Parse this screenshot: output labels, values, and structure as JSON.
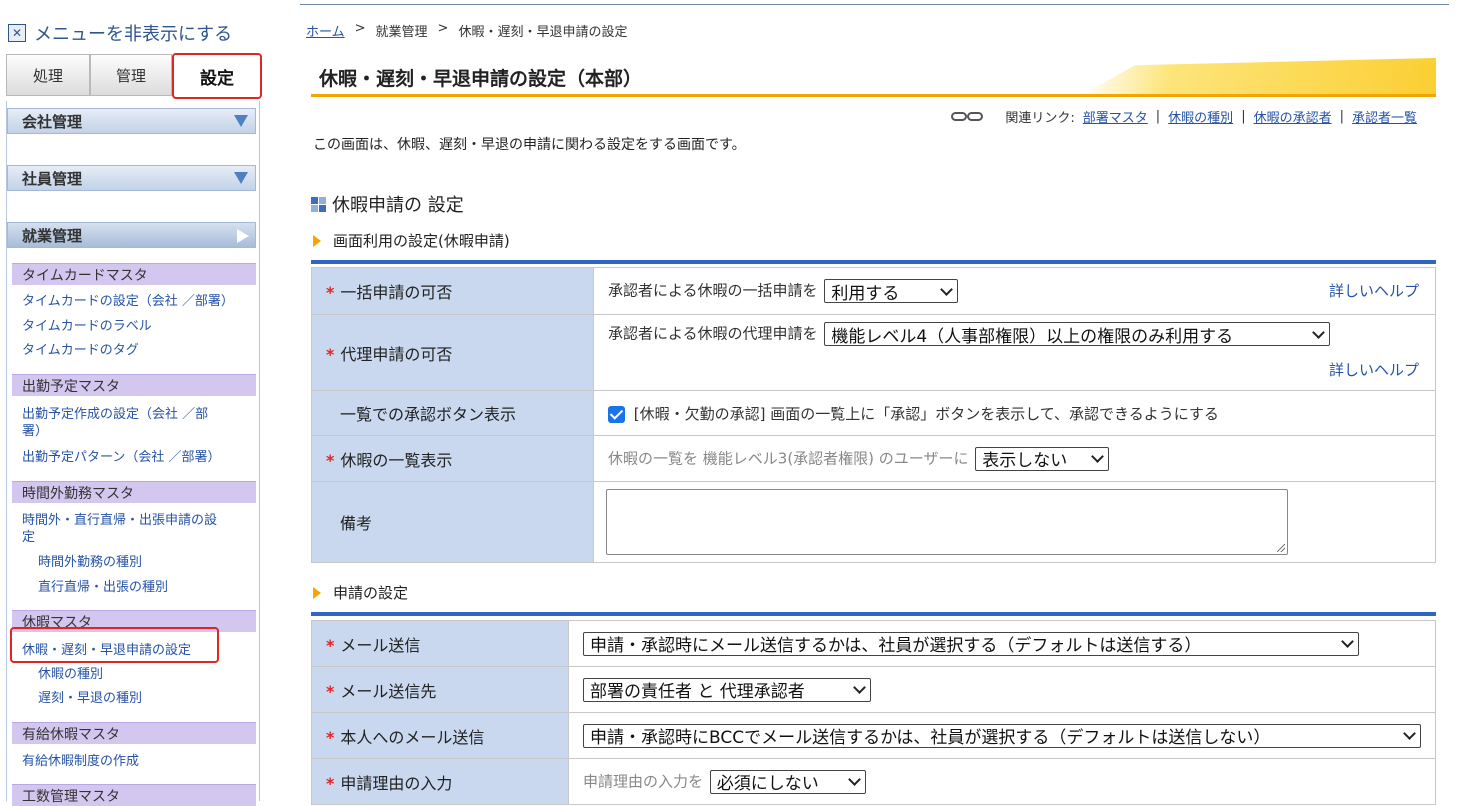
{
  "sidebar": {
    "hide_menu": "メニューを非表示にする",
    "tabs": [
      "処理",
      "管理",
      "設定"
    ],
    "categories": [
      "会社管理",
      "社員管理",
      "就業管理"
    ],
    "groups": [
      {
        "title": "タイムカードマスタ",
        "items": [
          "タイムカードの設定（会社 ／部署）",
          "タイムカードのラベル",
          "タイムカードのタグ"
        ]
      },
      {
        "title": "出勤予定マスタ",
        "items": [
          "出勤予定作成の設定（会社 ／部",
          "署）",
          "出勤予定パターン（会社 ／部署）"
        ]
      },
      {
        "title": "時間外勤務マスタ",
        "items": [
          "時間外・直行直帰・出張申請の設",
          "定",
          "時間外勤務の種別",
          "直行直帰・出張の種別"
        ]
      },
      {
        "title": "休暇マスタ",
        "items": [
          "休暇・遅刻・早退申請の設定",
          "休暇の種別",
          "遅刻・早退の種別"
        ]
      },
      {
        "title": "有給休暇マスタ",
        "items": [
          "有給休暇制度の作成"
        ]
      },
      {
        "title": "工数管理マスタ",
        "items": []
      }
    ]
  },
  "breadcrumb": {
    "home": "ホーム",
    "sep": ">",
    "level1": "就業管理",
    "current": "休暇・遅刻・早退申請の設定"
  },
  "page_title": "休暇・遅刻・早退申請の設定（本部）",
  "related": {
    "label": "関連リンク:",
    "links": [
      "部署マスタ",
      "休暇の種別",
      "休暇の承認者",
      "承認者一覧"
    ],
    "sep": "|"
  },
  "description": "この画面は、休暇、遅刻・早退の申請に関わる設定をする画面です。",
  "section_title": "休暇申請の 設定",
  "subsection1": "画面利用の設定(休暇申請)",
  "subsection2": "申請の設定",
  "form1": {
    "bulk": {
      "label": "一括申請の可否",
      "text": "承認者による休暇の一括申請を",
      "value": "利用する",
      "help": "詳しいヘルプ"
    },
    "proxy": {
      "label": "代理申請の可否",
      "text": "承認者による休暇の代理申請を",
      "value": "機能レベル4（人事部権限）以上の権限のみ利用する",
      "help": "詳しいヘルプ"
    },
    "approve_btn": {
      "label": "一覧での承認ボタン表示",
      "text": "[休暇・欠勤の承認] 画面の一覧上に「承認」ボタンを表示して、承認できるようにする"
    },
    "list_display": {
      "label": "休暇の一覧表示",
      "text": "休暇の一覧を 機能レベル3(承認者権限) のユーザーに",
      "value": "表示しない"
    },
    "notes": {
      "label": "備考",
      "value": ""
    }
  },
  "form2": {
    "mail": {
      "label": "メール送信",
      "value": "申請・承認時にメール送信するかは、社員が選択する（デフォルトは送信する）"
    },
    "mail_to": {
      "label": "メール送信先",
      "value": "部署の責任者 と 代理承認者"
    },
    "self_mail": {
      "label": "本人へのメール送信",
      "value": "申請・承認時にBCCでメール送信するかは、社員が選択する（デフォルトは送信しない）"
    },
    "reason": {
      "label": "申請理由の入力",
      "text": "申請理由の入力を",
      "value": "必須にしない"
    }
  },
  "required_mark": "*",
  "colors": {
    "accent_orange": "#f5a500",
    "label_bg": "#c9d8ee",
    "link": "#2653a6",
    "highlight_red": "#e12424",
    "group_purple": "#d4c7ef"
  }
}
